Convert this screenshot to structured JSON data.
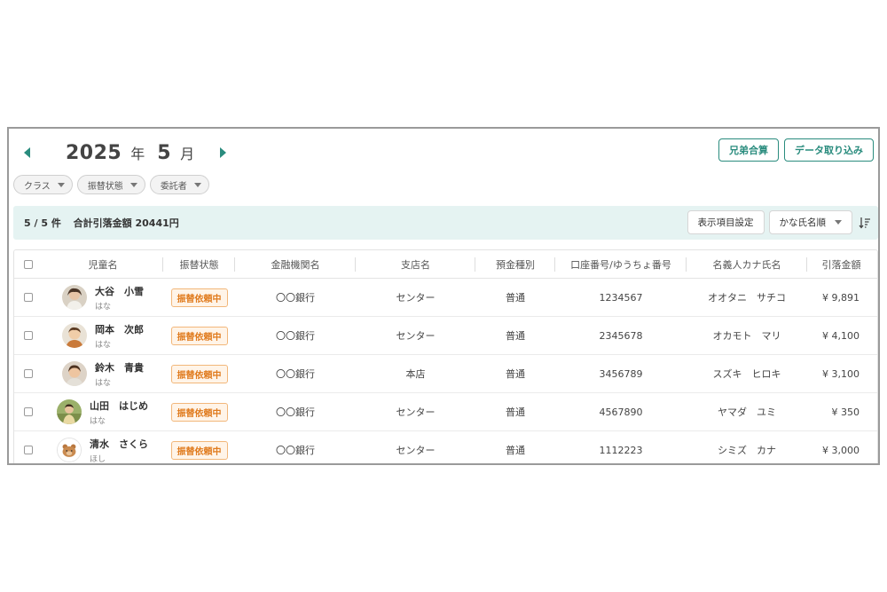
{
  "header": {
    "year": "2025",
    "year_unit": "年",
    "month": "5",
    "month_unit": "月",
    "buttons": {
      "sibling_merge": "兄弟合算",
      "data_import": "データ取り込み"
    }
  },
  "filters": [
    {
      "label": "クラス"
    },
    {
      "label": "振替状態"
    },
    {
      "label": "委託者"
    }
  ],
  "summary": {
    "count": "5 / 5 件",
    "total": "合計引落金額 20441円",
    "column_settings": "表示項目設定",
    "sort_select": "かな氏名順"
  },
  "table": {
    "headers": [
      "児童名",
      "振替状態",
      "金融機関名",
      "支店名",
      "預金種別",
      "口座番号/ゆうちょ番号",
      "名義人カナ氏名",
      "引落金額"
    ],
    "rows": [
      {
        "name": "大谷　小雪",
        "kana": "はな",
        "status": "振替依頼中",
        "bank": "〇〇銀行",
        "branch": "センター",
        "type": "普通",
        "account": "1234567",
        "holder": "オオタニ　サチコ",
        "amount": "¥ 9,891",
        "avatar": "avatar-girl-icon"
      },
      {
        "name": "岡本　次郎",
        "kana": "はな",
        "status": "振替依頼中",
        "bank": "〇〇銀行",
        "branch": "センター",
        "type": "普通",
        "account": "2345678",
        "holder": "オカモト　マリ",
        "amount": "¥ 4,100",
        "avatar": "avatar-child-icon"
      },
      {
        "name": "鈴木　青貴",
        "kana": "はな",
        "status": "振替依頼中",
        "bank": "〇〇銀行",
        "branch": "本店",
        "type": "普通",
        "account": "3456789",
        "holder": "スズキ　ヒロキ",
        "amount": "¥ 3,100",
        "avatar": "avatar-child-icon"
      },
      {
        "name": "山田　はじめ",
        "kana": "はな",
        "status": "振替依頼中",
        "bank": "〇〇銀行",
        "branch": "センター",
        "type": "普通",
        "account": "4567890",
        "holder": "ヤマダ　ユミ",
        "amount": "¥ 350",
        "avatar": "avatar-field-icon"
      },
      {
        "name": "清水　さくら",
        "kana": "ほし",
        "status": "振替依頼中",
        "bank": "〇〇銀行",
        "branch": "センター",
        "type": "普通",
        "account": "1112223",
        "holder": "シミズ　カナ",
        "amount": "¥ 3,000",
        "avatar": "avatar-bear-icon"
      }
    ]
  },
  "colors": {
    "accent": "#2a8c7e",
    "summary_bg": "#e5f3f2",
    "badge_text": "#e07b1e",
    "badge_bg": "#fff4e8"
  }
}
